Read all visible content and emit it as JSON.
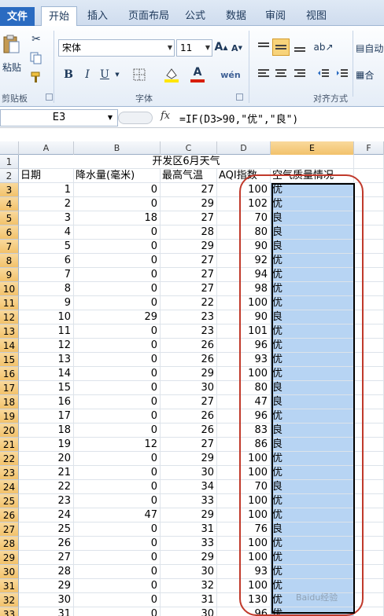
{
  "ribbon": {
    "tabs": [
      "文件",
      "开始",
      "插入",
      "页面布局",
      "公式",
      "数据",
      "审阅",
      "视图"
    ],
    "clipboard": {
      "paste": "粘贴",
      "group": "剪贴板"
    },
    "font": {
      "name": "宋体",
      "size": "11",
      "group": "字体",
      "bold": "B",
      "italic": "I",
      "underline": "U",
      "grow": "A",
      "shrink": "A",
      "color": "A",
      "phonetic": "wén"
    },
    "align": {
      "group": "对齐方式",
      "wrap": "自动",
      "merge": "合"
    }
  },
  "formula_bar": {
    "cell_ref": "E3",
    "fx": "fx",
    "formula": "=IF(D3>90,\"优\",\"良\")"
  },
  "grid": {
    "columns": [
      "A",
      "B",
      "C",
      "D",
      "E",
      "F"
    ],
    "row_numbers": [
      "1",
      "2",
      "3",
      "4",
      "5",
      "6",
      "7",
      "8",
      "9",
      "10",
      "11",
      "12",
      "13",
      "14",
      "15",
      "16",
      "17",
      "18",
      "19",
      "20",
      "21",
      "22",
      "23",
      "24",
      "25",
      "26",
      "27",
      "28",
      "29",
      "30",
      "31",
      "32",
      "33"
    ],
    "title": "开发区6月天气",
    "headers": [
      "日期",
      "降水量(毫米)",
      "最高气温",
      "AQI指数",
      "空气质量情况"
    ],
    "rows": [
      [
        "1",
        "0",
        "27",
        "100",
        "优"
      ],
      [
        "2",
        "0",
        "29",
        "102",
        "优"
      ],
      [
        "3",
        "18",
        "27",
        "70",
        "良"
      ],
      [
        "4",
        "0",
        "28",
        "80",
        "良"
      ],
      [
        "5",
        "0",
        "29",
        "90",
        "良"
      ],
      [
        "6",
        "0",
        "27",
        "92",
        "优"
      ],
      [
        "7",
        "0",
        "27",
        "94",
        "优"
      ],
      [
        "8",
        "0",
        "27",
        "98",
        "优"
      ],
      [
        "9",
        "0",
        "22",
        "100",
        "优"
      ],
      [
        "10",
        "29",
        "23",
        "90",
        "良"
      ],
      [
        "11",
        "0",
        "23",
        "101",
        "优"
      ],
      [
        "12",
        "0",
        "26",
        "96",
        "优"
      ],
      [
        "13",
        "0",
        "26",
        "93",
        "优"
      ],
      [
        "14",
        "0",
        "29",
        "100",
        "优"
      ],
      [
        "15",
        "0",
        "30",
        "80",
        "良"
      ],
      [
        "16",
        "0",
        "27",
        "47",
        "良"
      ],
      [
        "17",
        "0",
        "26",
        "96",
        "优"
      ],
      [
        "18",
        "0",
        "26",
        "83",
        "良"
      ],
      [
        "19",
        "12",
        "27",
        "86",
        "良"
      ],
      [
        "20",
        "0",
        "29",
        "100",
        "优"
      ],
      [
        "21",
        "0",
        "30",
        "100",
        "优"
      ],
      [
        "22",
        "0",
        "34",
        "70",
        "良"
      ],
      [
        "23",
        "0",
        "33",
        "100",
        "优"
      ],
      [
        "24",
        "47",
        "29",
        "100",
        "优"
      ],
      [
        "25",
        "0",
        "31",
        "76",
        "良"
      ],
      [
        "26",
        "0",
        "33",
        "100",
        "优"
      ],
      [
        "27",
        "0",
        "29",
        "100",
        "优"
      ],
      [
        "28",
        "0",
        "30",
        "93",
        "优"
      ],
      [
        "29",
        "0",
        "32",
        "100",
        "优"
      ],
      [
        "30",
        "0",
        "31",
        "130",
        "优"
      ],
      [
        "31",
        "0",
        "30",
        "96",
        "优"
      ]
    ]
  },
  "watermark": "Baidu经验"
}
